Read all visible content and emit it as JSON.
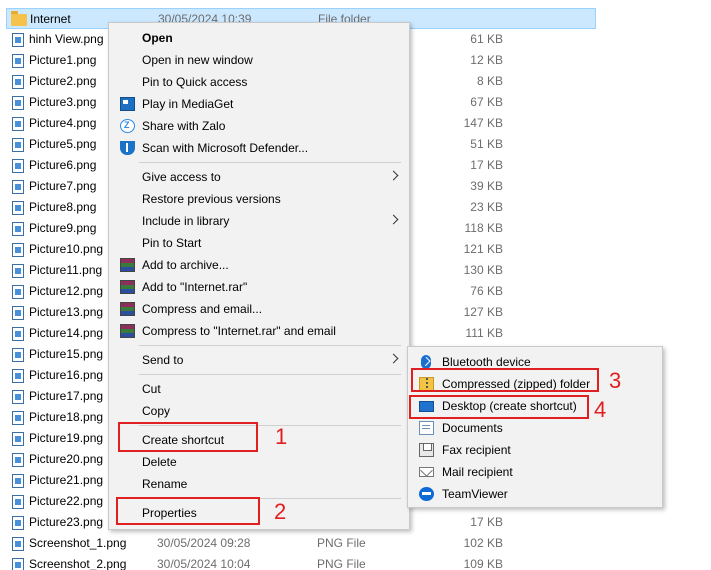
{
  "files": [
    {
      "name": "Internet",
      "date": "30/05/2024 10:39",
      "type": "File folder",
      "size": "",
      "kind": "folder",
      "selected": true
    },
    {
      "name": "hinh View.png",
      "size": "61 KB",
      "kind": "image"
    },
    {
      "name": "Picture1.png",
      "size": "12 KB",
      "kind": "image"
    },
    {
      "name": "Picture2.png",
      "size": "8 KB",
      "kind": "image"
    },
    {
      "name": "Picture3.png",
      "size": "67 KB",
      "kind": "image"
    },
    {
      "name": "Picture4.png",
      "size": "147 KB",
      "kind": "image"
    },
    {
      "name": "Picture5.png",
      "size": "51 KB",
      "kind": "image"
    },
    {
      "name": "Picture6.png",
      "size": "17 KB",
      "kind": "image"
    },
    {
      "name": "Picture7.png",
      "size": "39 KB",
      "kind": "image"
    },
    {
      "name": "Picture8.png",
      "size": "23 KB",
      "kind": "image"
    },
    {
      "name": "Picture9.png",
      "size": "118 KB",
      "kind": "image"
    },
    {
      "name": "Picture10.png",
      "size": "121 KB",
      "kind": "image"
    },
    {
      "name": "Picture11.png",
      "size": "130 KB",
      "kind": "image"
    },
    {
      "name": "Picture12.png",
      "size": "76 KB",
      "kind": "image"
    },
    {
      "name": "Picture13.png",
      "size": "127 KB",
      "kind": "image"
    },
    {
      "name": "Picture14.png",
      "size": "111 KB",
      "kind": "image"
    },
    {
      "name": "Picture15.png",
      "size": "",
      "kind": "image"
    },
    {
      "name": "Picture16.png",
      "size": "",
      "kind": "image"
    },
    {
      "name": "Picture17.png",
      "size": "",
      "kind": "image"
    },
    {
      "name": "Picture18.png",
      "size": "",
      "kind": "image"
    },
    {
      "name": "Picture19.png",
      "size": "",
      "kind": "image"
    },
    {
      "name": "Picture20.png",
      "size": "",
      "kind": "image"
    },
    {
      "name": "Picture21.png",
      "size": "",
      "kind": "image"
    },
    {
      "name": "Picture22.png",
      "size": "",
      "kind": "image"
    },
    {
      "name": "Picture23.png",
      "size": "17 KB",
      "kind": "image"
    },
    {
      "name": "Screenshot_1.png",
      "date": "30/05/2024 09:28",
      "type": "PNG File",
      "size": "102 KB",
      "kind": "image"
    },
    {
      "name": "Screenshot_2.png",
      "date": "30/05/2024 10:04",
      "type": "PNG File",
      "size": "109 KB",
      "kind": "image"
    }
  ],
  "context_menu": {
    "open": "Open",
    "open_new_window": "Open in new window",
    "pin_quick_access": "Pin to Quick access",
    "play_mediaget": "Play in MediaGet",
    "share_zalo": "Share with Zalo",
    "scan_defender": "Scan with Microsoft Defender...",
    "give_access": "Give access to",
    "restore_versions": "Restore previous versions",
    "include_library": "Include in library",
    "pin_start": "Pin to Start",
    "add_archive": "Add to archive...",
    "add_internet_rar": "Add to \"Internet.rar\"",
    "compress_email": "Compress and email...",
    "compress_rar_email": "Compress to \"Internet.rar\" and email",
    "send_to": "Send to",
    "cut": "Cut",
    "copy": "Copy",
    "create_shortcut": "Create shortcut",
    "delete": "Delete",
    "rename": "Rename",
    "properties": "Properties"
  },
  "send_to_menu": {
    "bluetooth": "Bluetooth device",
    "compressed": "Compressed (zipped) folder",
    "desktop": "Desktop (create shortcut)",
    "documents": "Documents",
    "fax": "Fax recipient",
    "mail": "Mail recipient",
    "teamviewer": "TeamViewer"
  },
  "annotations": [
    "1",
    "2",
    "3",
    "4"
  ],
  "colors": {
    "annotation": "#e02020",
    "selection": "#cce8ff",
    "menu_bg": "#f2f2f2"
  }
}
